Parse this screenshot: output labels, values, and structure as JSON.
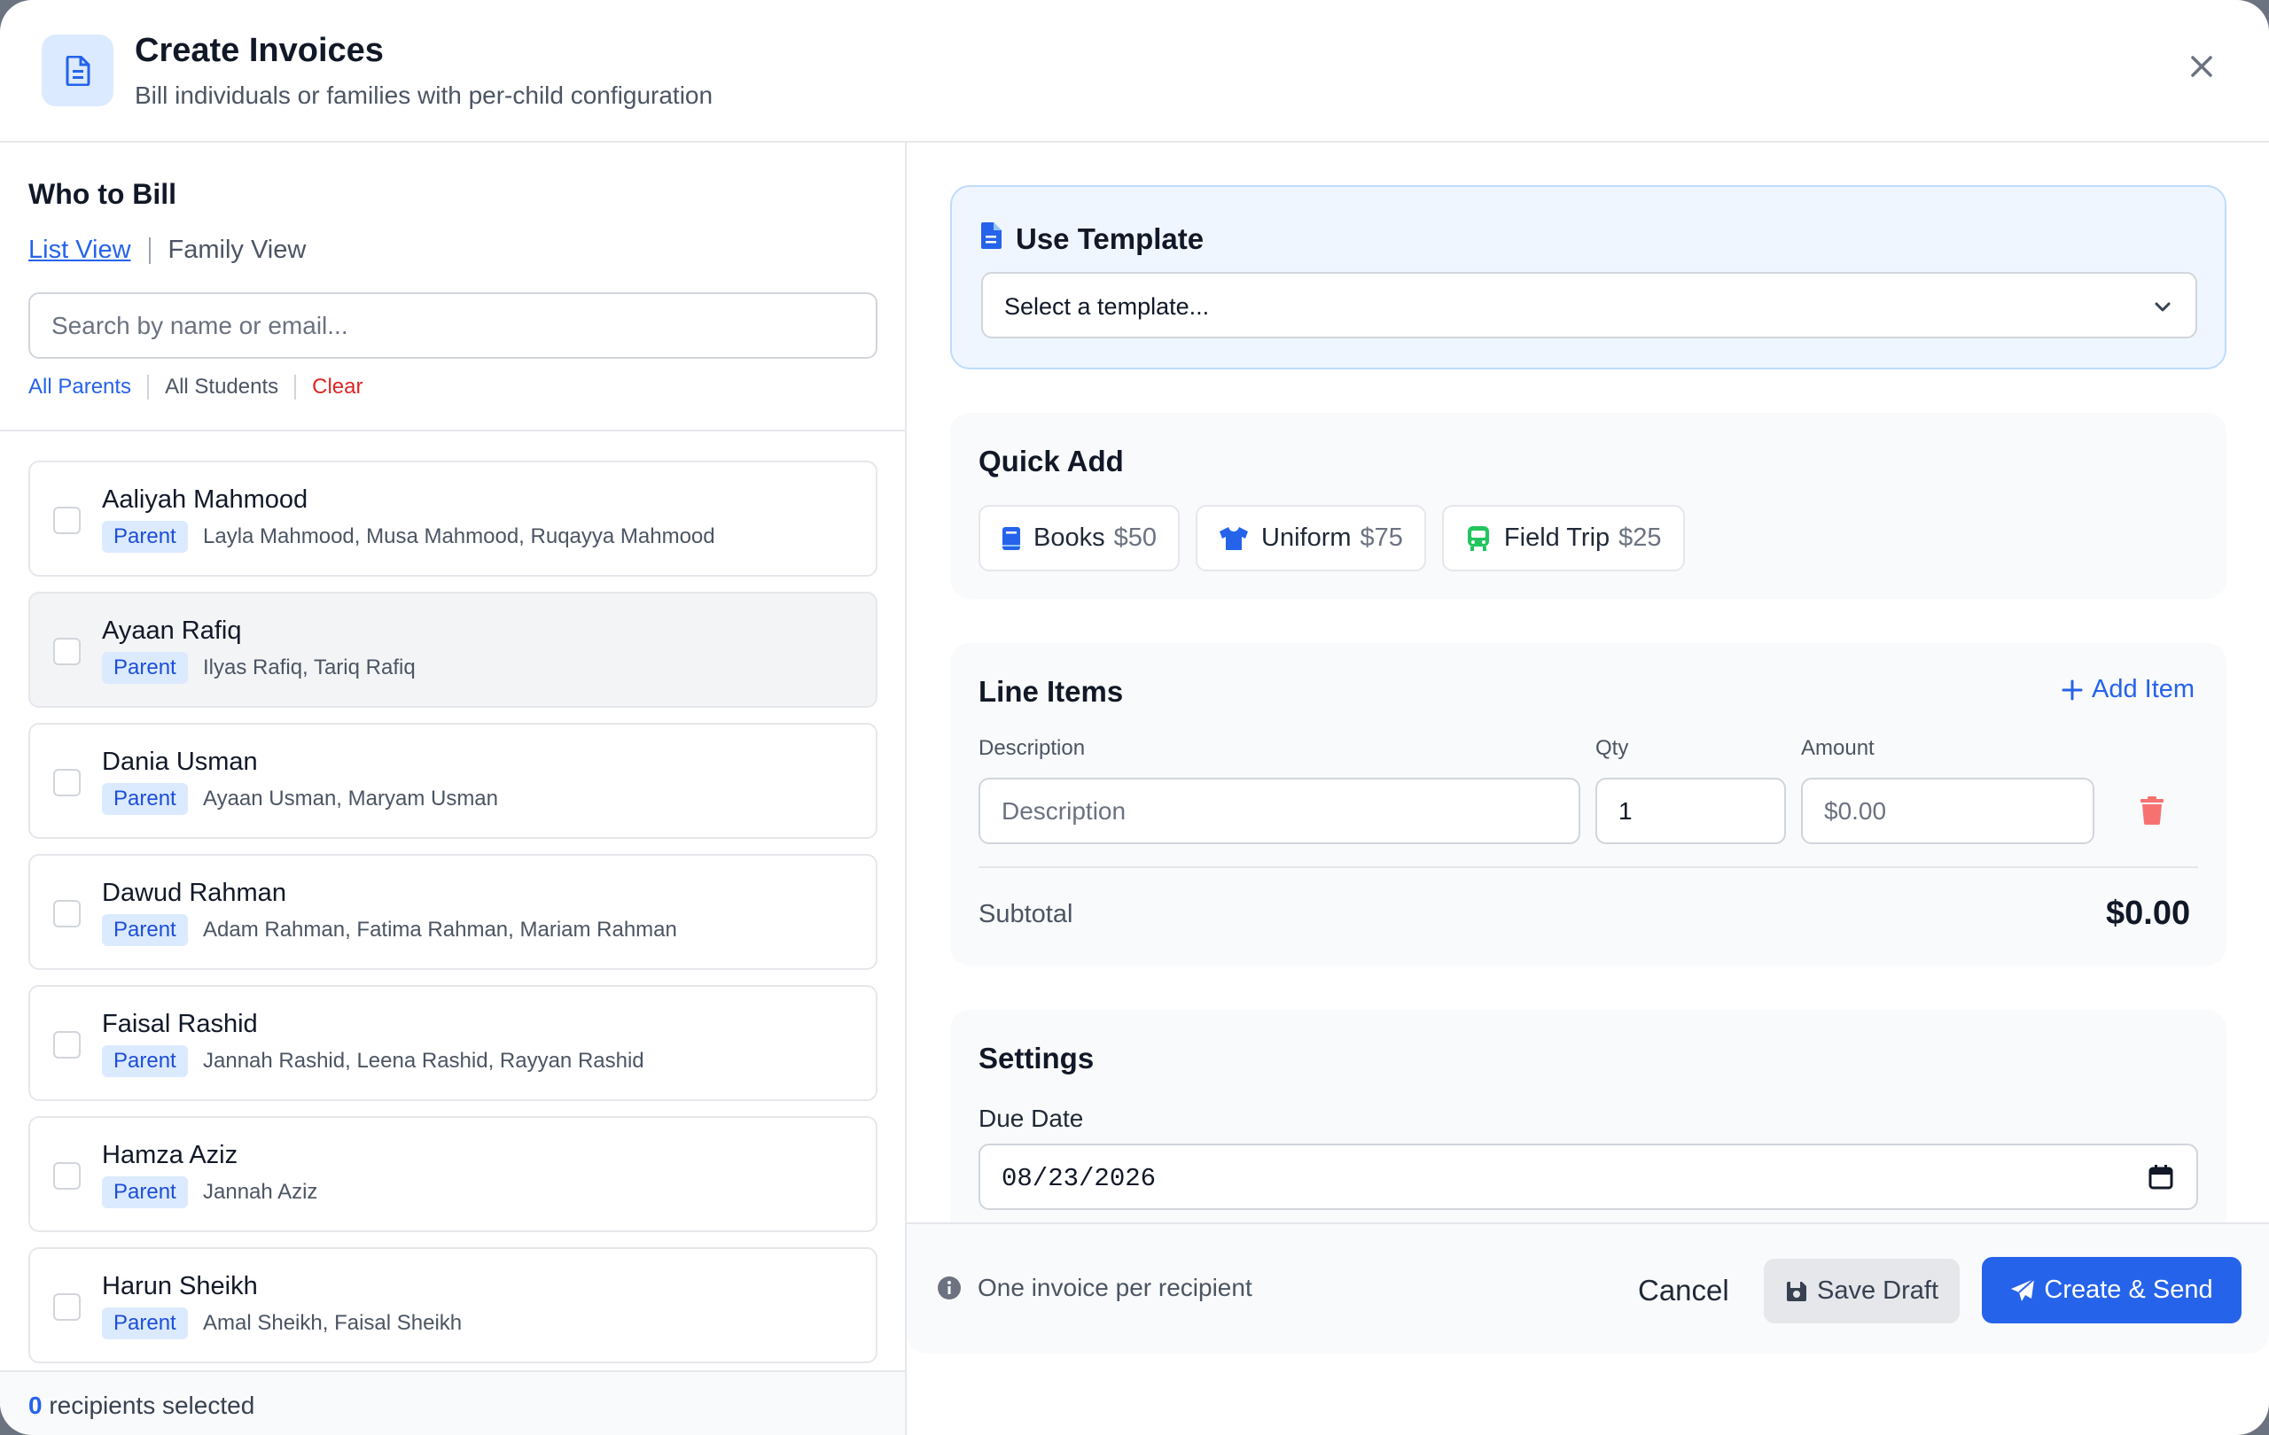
{
  "header": {
    "title": "Create Invoices",
    "subtitle": "Bill individuals or families with per-child configuration",
    "icon": "invoice-document-icon",
    "close_icon": "close-icon"
  },
  "who_to_bill": {
    "title": "Who to Bill",
    "views": {
      "list": "List View",
      "family": "Family View"
    },
    "search_placeholder": "Search by name or email...",
    "filters": {
      "all_parents": "All Parents",
      "all_students": "All Students",
      "clear": "Clear"
    },
    "recipients": [
      {
        "name": "Aaliyah Mahmood",
        "role": "Parent",
        "children": "Layla Mahmood, Musa Mahmood, Ruqayya Mahmood"
      },
      {
        "name": "Ayaan Rafiq",
        "role": "Parent",
        "children": "Ilyas Rafiq, Tariq Rafiq"
      },
      {
        "name": "Dania Usman",
        "role": "Parent",
        "children": "Ayaan Usman, Maryam Usman"
      },
      {
        "name": "Dawud Rahman",
        "role": "Parent",
        "children": "Adam Rahman, Fatima Rahman, Mariam Rahman"
      },
      {
        "name": "Faisal Rashid",
        "role": "Parent",
        "children": "Jannah Rashid, Leena Rashid, Rayyan Rashid"
      },
      {
        "name": "Hamza Aziz",
        "role": "Parent",
        "children": "Jannah Aziz"
      },
      {
        "name": "Harun Sheikh",
        "role": "Parent",
        "children": "Amal Sheikh, Faisal Sheikh"
      }
    ],
    "selected_count": "0",
    "selected_suffix": "recipients selected"
  },
  "template": {
    "title": "Use Template",
    "select_value": "Select a template..."
  },
  "quick_add": {
    "title": "Quick Add",
    "items": [
      {
        "label": "Books",
        "price": "$50",
        "icon": "book-icon"
      },
      {
        "label": "Uniform",
        "price": "$75",
        "icon": "shirt-icon"
      },
      {
        "label": "Field Trip",
        "price": "$25",
        "icon": "bus-icon"
      }
    ]
  },
  "line_items": {
    "title": "Line Items",
    "add_label": "Add Item",
    "columns": {
      "description": "Description",
      "qty": "Qty",
      "amount": "Amount"
    },
    "row": {
      "description_placeholder": "Description",
      "qty": "1",
      "amount_placeholder": "$0.00"
    },
    "subtotal_label": "Subtotal",
    "subtotal_value": "$0.00"
  },
  "settings": {
    "title": "Settings",
    "due_date_label": "Due Date",
    "due_date_value": "08/23/2026"
  },
  "footer": {
    "info": "One invoice per recipient",
    "cancel": "Cancel",
    "save_draft": "Save Draft",
    "create_send": "Create & Send"
  },
  "colors": {
    "accent": "#2563eb",
    "danger": "#dc2626",
    "template_bg": "#eff6ff",
    "trash": "#f87171"
  }
}
